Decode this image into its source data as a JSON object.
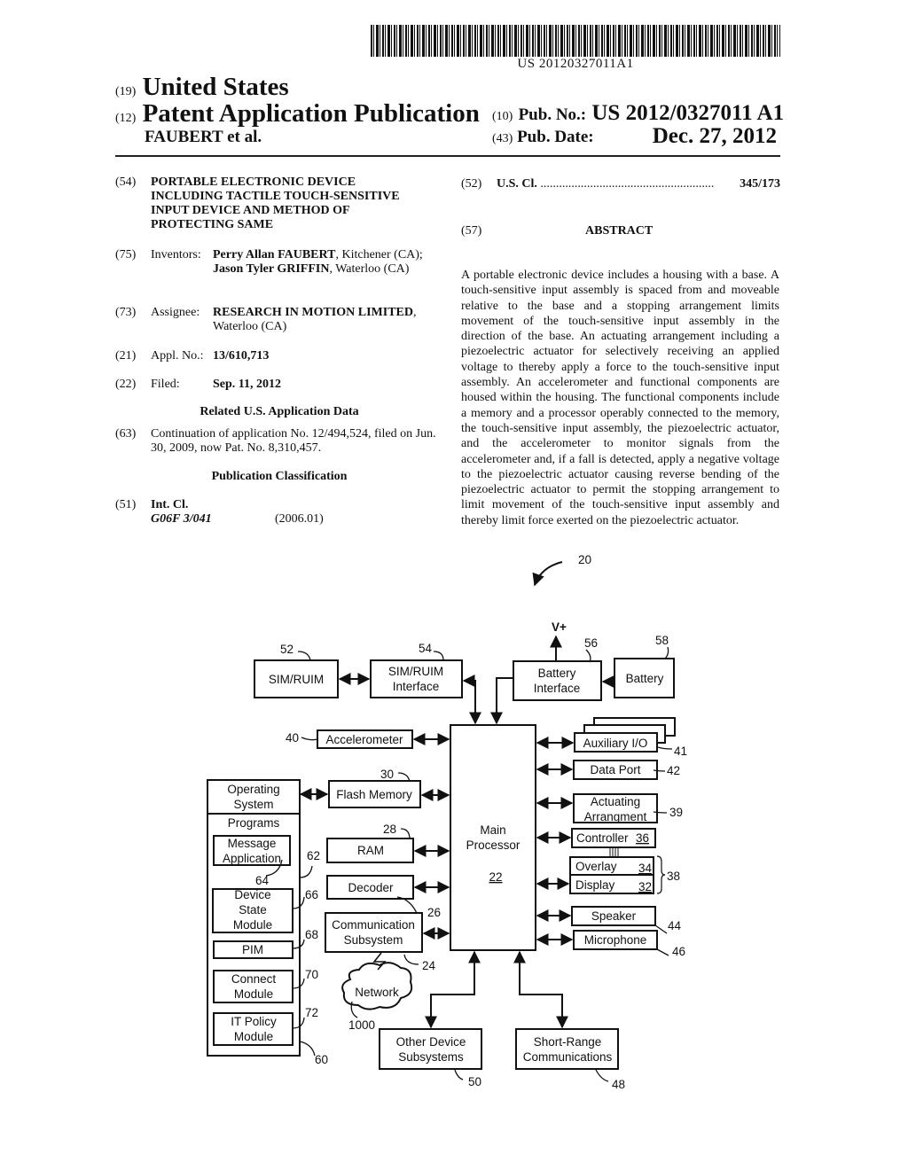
{
  "header": {
    "barcode_text": "US 20120327011A1",
    "country_code": "(19)",
    "country": "United States",
    "type_code": "(12)",
    "type": "Patent Application Publication",
    "author": "FAUBERT et al.",
    "pub_no_code": "(10)",
    "pub_no_label": "Pub. No.:",
    "pub_no": "US 2012/0327011 A1",
    "pub_date_code": "(43)",
    "pub_date_label": "Pub. Date:",
    "pub_date": "Dec. 27, 2012"
  },
  "biblio": {
    "title_code": "(54)",
    "title_lines": [
      "PORTABLE ELECTRONIC DEVICE",
      "INCLUDING TACTILE TOUCH-SENSITIVE",
      "INPUT DEVICE AND METHOD OF",
      "PROTECTING SAME"
    ],
    "inventors_code": "(75)",
    "inventors_label": "Inventors:",
    "inventor1_name": "Perry Allan FAUBERT",
    "inventor1_loc": ", Kitchener (CA); ",
    "inventor2_name": "Jason Tyler GRIFFIN",
    "inventor2_loc": ", Waterloo (CA)",
    "assignee_code": "(73)",
    "assignee_label": "Assignee:",
    "assignee_name": "RESEARCH IN MOTION LIMITED",
    "assignee_loc": ", Waterloo (CA)",
    "appl_code": "(21)",
    "appl_label": "Appl. No.:",
    "appl_no": "13/610,713",
    "filed_code": "(22)",
    "filed_label": "Filed:",
    "filed_date": "Sep. 11, 2012",
    "related_head": "Related U.S. Application Data",
    "continuation_code": "(63)",
    "continuation_text": "Continuation of application No. 12/494,524, filed on Jun. 30, 2009, now Pat. No. 8,310,457.",
    "pubclass_head": "Publication Classification",
    "intcl_code": "(51)",
    "intcl_label": "Int. Cl.",
    "intcl_class": "G06F 3/041",
    "intcl_version": "(2006.01)",
    "uscl_code": "(52)",
    "uscl_label": "U.S. Cl.",
    "uscl_dots": "........................................................",
    "uscl_value": "345/173",
    "abstract_code": "(57)",
    "abstract_head": "ABSTRACT",
    "abstract": "A portable electronic device includes a housing with a base. A touch-sensitive input assembly is spaced from and moveable relative to the base and a stopping arrangement limits movement of the touch-sensitive input assembly in the direction of the base. An actuating arrangement including a piezoelectric actuator for selectively receiving an applied voltage to thereby apply a force to the touch-sensitive input assembly. An accelerometer and functional components are housed within the housing. The functional components include a memory and a processor operably connected to the memory, the touch-sensitive input assembly, the piezoelectric actuator, and the accelerometer to monitor signals from the accelerometer and, if a fall is detected, apply a negative voltage to the piezoelectric actuator causing reverse bending of the piezoelectric actuator to permit the stopping arrangement to limit movement of the touch-sensitive input assembly and thereby limit force exerted on the piezoelectric actuator."
  },
  "figure": {
    "ref_figure": "20",
    "vplus": "V+",
    "blocks": {
      "sim_ruim": {
        "label": "SIM/RUIM",
        "ref": "52"
      },
      "sim_ruim_interface": {
        "line1": "SIM/RUIM",
        "line2": "Interface",
        "ref": "54"
      },
      "battery_interface": {
        "line1": "Battery",
        "line2": "Interface",
        "ref": "56"
      },
      "battery": {
        "label": "Battery",
        "ref": "58"
      },
      "accelerometer": {
        "label": "Accelerometer",
        "ref": "40"
      },
      "flash_memory": {
        "label": "Flash Memory",
        "ref": "30"
      },
      "ram": {
        "label": "RAM",
        "ref": "28"
      },
      "decoder": {
        "label": "Decoder",
        "ref": "26"
      },
      "comm_subsystem": {
        "line1": "Communication",
        "line2": "Subsystem",
        "ref": "24"
      },
      "main_processor": {
        "line1": "Main",
        "line2": "Processor",
        "ref": "22"
      },
      "aux_io": {
        "label": "Auxiliary I/O",
        "ref": "41"
      },
      "data_port": {
        "label": "Data Port",
        "ref": "42"
      },
      "actuating": {
        "line1": "Actuating",
        "line2": "Arrangment",
        "ref": "39"
      },
      "controller": {
        "label": "Controller",
        "ref": "36"
      },
      "overlay": {
        "label": "Overlay",
        "ref": "34"
      },
      "display": {
        "label": "Display",
        "ref": "32"
      },
      "touchscreen_group_ref": "38",
      "speaker": {
        "label": "Speaker",
        "ref": "44"
      },
      "microphone": {
        "label": "Microphone",
        "ref": "46"
      },
      "network": {
        "label": "Network",
        "ref": "1000"
      },
      "other_subsystems": {
        "line1": "Other Device",
        "line2": "Subsystems",
        "ref": "50"
      },
      "short_range": {
        "line1": "Short-Range",
        "line2": "Communications",
        "ref": "48"
      },
      "os": {
        "line1": "Operating",
        "line2": "System",
        "programs": "Programs",
        "ref": "60",
        "programs_ref": "62"
      },
      "message_app": {
        "line1": "Message",
        "line2": "Application",
        "ref": "64"
      },
      "device_state": {
        "line1": "Device",
        "line2": "State",
        "line3": "Module",
        "ref": "66"
      },
      "pim": {
        "label": "PIM",
        "ref": "68"
      },
      "connect": {
        "line1": "Connect",
        "line2": "Module",
        "ref": "70"
      },
      "it_policy": {
        "line1": "IT Policy",
        "line2": "Module",
        "ref": "72"
      }
    }
  }
}
